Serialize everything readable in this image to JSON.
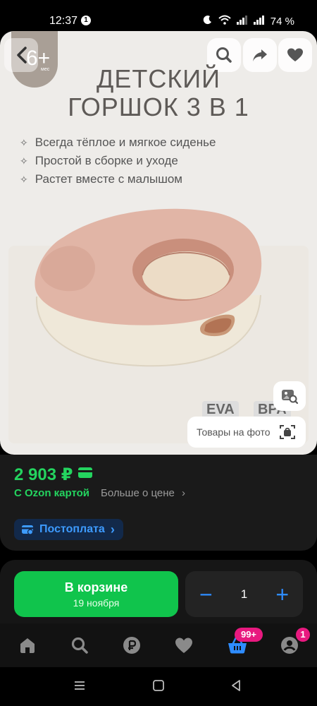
{
  "status_bar": {
    "time": "12:37",
    "notif_count": "1",
    "battery": "74 %"
  },
  "product": {
    "age_badge_num": "6+",
    "age_badge_unit": "мес",
    "title_line1": "ДЕТСКИЙ",
    "title_line2": "ГОРШОК 3 В 1",
    "features": [
      "Всегда тёплое и мягкое сиденье",
      "Простой в сборке и уходе",
      "Растет вместе с малышом"
    ],
    "badge_eva": "EVA",
    "badge_bpa": "BPA",
    "photo_goods_label": "Товары на фото"
  },
  "price": {
    "amount": "2 903 ₽",
    "ozon_card_label": "С Ozon картой",
    "more_label": "Больше о цене",
    "postpay_label": "Постоплата"
  },
  "cart": {
    "button_title": "В корзине",
    "button_date": "19 ноября",
    "quantity": "1",
    "minus": "−",
    "plus": "+"
  },
  "bottom_nav": {
    "cart_badge": "99+",
    "profile_badge": "1",
    "items": [
      "home-icon",
      "search-icon",
      "ruble-icon",
      "heart-icon",
      "basket-icon",
      "profile-icon"
    ]
  },
  "colors": {
    "price_green": "#24d45f",
    "cart_green": "#10c44c",
    "accent_blue": "#2e8cff",
    "badge_pink": "#e8197f"
  }
}
